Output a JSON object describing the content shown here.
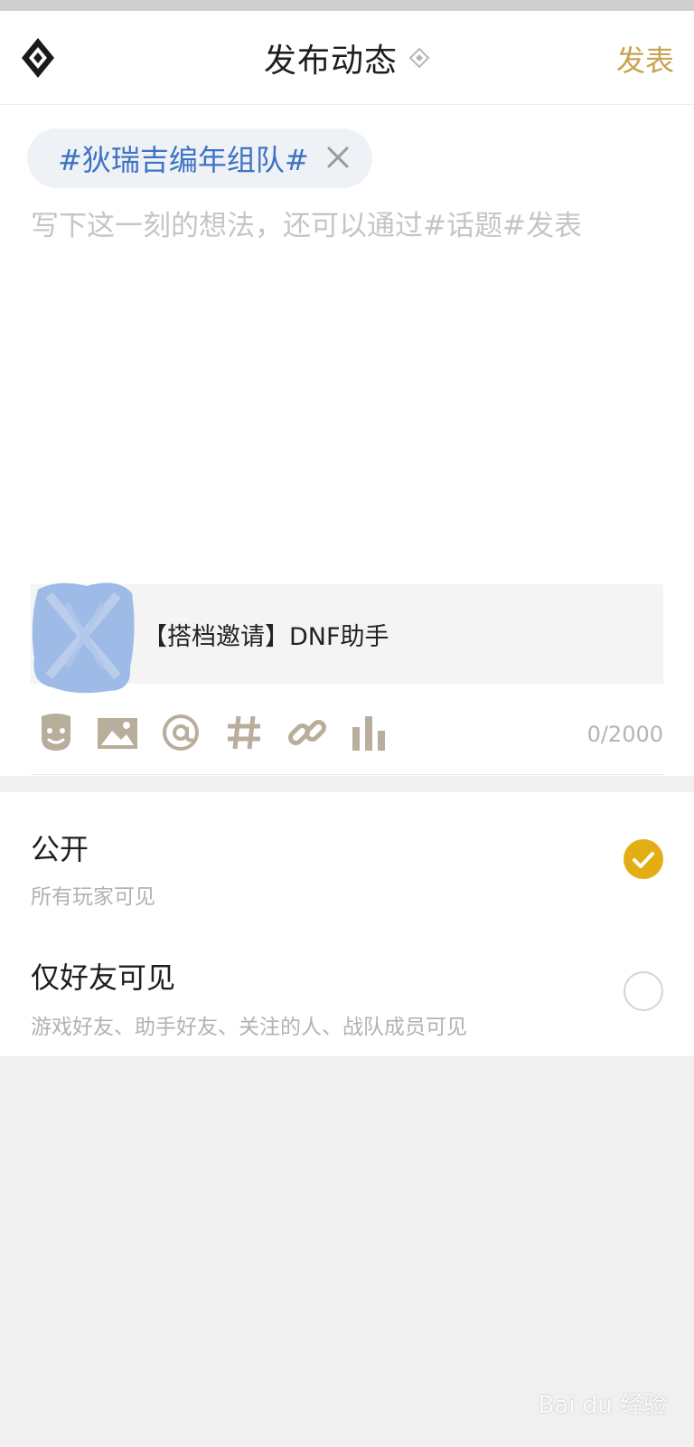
{
  "header": {
    "title": "发布动态",
    "publish_label": "发表"
  },
  "editor": {
    "topic": "#狄瑞吉编年组队#",
    "placeholder": "写下这一刻的想法，还可以通过#话题#发表"
  },
  "share_card": {
    "title": "【搭档邀请】DNF助手"
  },
  "toolbar": {
    "tools": [
      "emoji-icon",
      "image-icon",
      "mention-icon",
      "hashtag-icon",
      "link-icon",
      "chart-icon"
    ],
    "counter": "0/2000"
  },
  "visibility": {
    "options": [
      {
        "title": "公开",
        "subtitle": "所有玩家可见",
        "selected": true
      },
      {
        "title": "仅好友可见",
        "subtitle": "游戏好友、助手好友、关注的人、战队成员可见",
        "selected": false
      }
    ]
  },
  "colors": {
    "accent": "#c9a24f",
    "radio_selected": "#e3ad14",
    "topic": "#3d73c4",
    "icon": "#b9ad9c"
  },
  "watermark": "Bai du 经验"
}
